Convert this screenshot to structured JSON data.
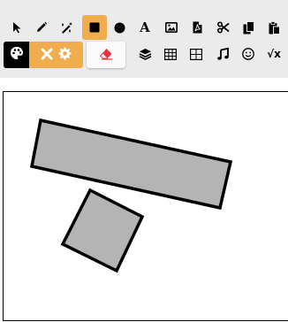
{
  "toolbar": {
    "row1": [
      {
        "name": "select-pointer-icon"
      },
      {
        "name": "pencil-icon"
      },
      {
        "name": "magic-wand-icon"
      },
      {
        "name": "square-icon",
        "active": true
      },
      {
        "name": "circle-icon"
      },
      {
        "name": "text-icon",
        "glyph": "A"
      },
      {
        "name": "image-icon"
      },
      {
        "name": "pdf-file-icon"
      },
      {
        "name": "scissors-icon"
      },
      {
        "name": "copy-icon"
      },
      {
        "name": "paste-icon"
      }
    ],
    "row2": [
      {
        "name": "palette-icon"
      },
      {
        "name": "close-icon"
      },
      {
        "name": "gear-icon"
      },
      {
        "name": "eraser-icon"
      },
      {
        "name": "layers-icon"
      },
      {
        "name": "table-grid-icon"
      },
      {
        "name": "border-grid-icon"
      },
      {
        "name": "music-note-icon"
      },
      {
        "name": "smiley-icon"
      },
      {
        "name": "square-root-x-icon",
        "glyph": "√x"
      }
    ],
    "colors": {
      "toolbar_bg": "#ebebeb",
      "accent": "#f0ad4e",
      "eraser": "#e8323c"
    }
  },
  "canvas": {
    "shapes": [
      {
        "type": "rectangle",
        "fill": "#b4b4b4",
        "stroke": "#000000",
        "rotation_deg": 11
      },
      {
        "type": "square",
        "fill": "#b4b4b4",
        "stroke": "#000000",
        "rotation_deg": 27
      }
    ]
  }
}
